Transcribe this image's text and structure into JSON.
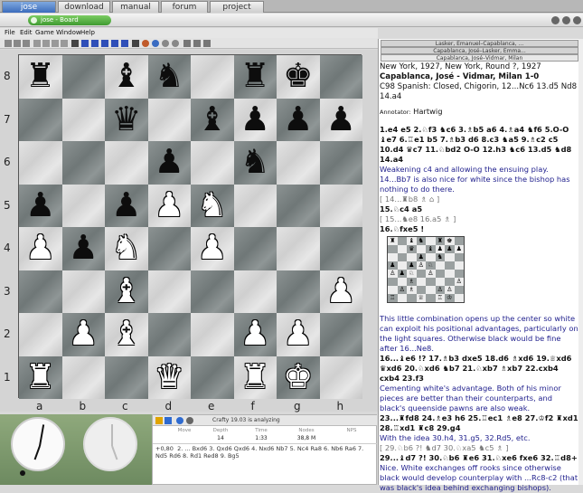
{
  "tabs": [
    {
      "label": "jose",
      "active": true
    },
    {
      "label": "download"
    },
    {
      "label": "manual"
    },
    {
      "label": "forum"
    },
    {
      "label": "project"
    }
  ],
  "window": {
    "title": "jose - Board"
  },
  "menu": [
    "File",
    "Edit",
    "Game",
    "Window",
    "Help"
  ],
  "board": {
    "ranks": [
      "8",
      "7",
      "6",
      "5",
      "4",
      "3",
      "2",
      "1"
    ],
    "files": [
      "a",
      "b",
      "c",
      "d",
      "e",
      "f",
      "g",
      "h"
    ],
    "position": [
      [
        "♜",
        "",
        "♝",
        "♞",
        "",
        "♜",
        "♚",
        ""
      ],
      [
        "",
        "",
        "♛",
        "",
        "♝",
        "♟",
        "♟",
        "♟"
      ],
      [
        "",
        "",
        "",
        "♟",
        "",
        "♞",
        "",
        ""
      ],
      [
        "♟",
        "",
        "♟",
        "♙",
        "♘",
        "",
        "",
        ""
      ],
      [
        "♙",
        "♟",
        "♘",
        "",
        "♙",
        "",
        "",
        ""
      ],
      [
        "",
        "",
        "♗",
        "",
        "",
        "",
        "",
        "♙"
      ],
      [
        "",
        "♙",
        "♗",
        "",
        "",
        "♙",
        "♙",
        ""
      ],
      [
        "♖",
        "",
        "",
        "♕",
        "",
        "♖",
        "♔",
        ""
      ]
    ]
  },
  "engine": {
    "status": "Crafty 19.03  is analyzing",
    "cols": [
      "Move",
      "Depth",
      "Time",
      "Nodes",
      "NPS"
    ],
    "depth": "14",
    "time": "1:33",
    "nodes": "38,8 M",
    "eval": "+0,80",
    "pv": "2. ... Bxd6 3. Qxd6 Qxd6 4. Nxd6 Nb7 5. Nc4 Ra8 6. Nb6 Ra6 7. Nd5 Rd6 8. Rd1 Red8 9. Bg5"
  },
  "games": [
    "Lasker, Emanuel–Capablanca, ...",
    "Capablanca, José–Lasker, Emma...",
    "Capablanca, José–Vidmar, Milan"
  ],
  "notation": {
    "place": "New York, 1927, New York, Round ?, 1927",
    "players": "Capablanca, José - Vidmar, Milan  1-0",
    "opening": "C98 Spanish: Closed, Chigorin, 12...Nc6 13.d5 Nd8 14.a4",
    "annotator_label": "Annotator:",
    "annotator": "Hartwig",
    "moves1": "1.e4 e5 2.♘f3 ♞c6 3.♗b5 a6 4.♗a4 ♞f6 5.O-O ♝e7 6.♖e1 b5 7.♗b3 d6 8.c3 ♞a5 9.♗c2 c5 10.d4 ♛c7 11.♘bd2 O-O 12.h3 ♞c6 13.d5 ♞d8 14.a4",
    "comment1": "Weakening c4 and allowing the ensuing play. 14...Bb7 is also nice for white since the bishop has nothing to do there.",
    "var1": "[ 14...♜b8 ♗ ⌂ ]",
    "moves2": "15.♘c4 a5",
    "var2": "[ 15...♞e8 16.a5 ♗ ]",
    "moves3": "16.♘fxe5 !",
    "mini": [
      "♜",
      "",
      "♝",
      "♞",
      "",
      "♜",
      "♚",
      "",
      "",
      "",
      "♛",
      "",
      "♝",
      "♟",
      "♟",
      "♟",
      "",
      "",
      "",
      "♟",
      "",
      "♞",
      "",
      "",
      "♟",
      "",
      "♟",
      "♙",
      "♘",
      "",
      "",
      "",
      "♙",
      "♟",
      "♘",
      "",
      "♙",
      "",
      "",
      "",
      "",
      "",
      "♗",
      "",
      "",
      "",
      "",
      "♙",
      "",
      "♙",
      "♗",
      "",
      "",
      "♙",
      "♙",
      "",
      "♖",
      "",
      "",
      "♕",
      "",
      "♖",
      "♔",
      ""
    ],
    "comment2": "This little combination opens up the center so white can exploit his positional advantages, particularly on the light squares. Otherwise black would be fine after 16...Ne8.",
    "moves4": "16...♝e6 !? 17.♗b3 dxe5 18.d6 ♗xd6 19.♕xd6 ♛xd6 20.♘xd6 ♞b7 21.♘xb7 ♗xb7 22.cxb4 cxb4 23.f3",
    "comment3": "Cementing white's advantage. Both of his minor pieces are better than their counterparts, and black's queenside pawns are also weak.",
    "moves5": "23...♜fd8 24.♗e3 h6 25.♖ec1 ♗e8 27.♔f2 ♜xd1 28.♖xd1 ♜c8 29.g4",
    "comment4": "With the idea 30.h4, 31.g5, 32.Rd5, etc.",
    "var3": "[ 29.♘b6 ?! ♞d7 30.♘xa5 ♞c5 ♗ ]",
    "moves6": "29...♝d7 ?! 30.♘b6 ♜e6 31.♘xe6 fxe6 32.♖d8+",
    "comment5": "Nice. White exchanges off rooks since otherwise black would develop counterplay with ...Rc8-c2 (that was black's idea behind exchanging bishops)."
  }
}
